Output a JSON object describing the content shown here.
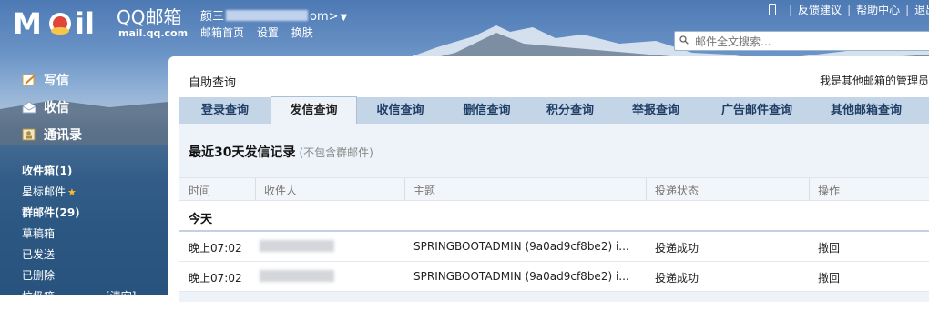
{
  "header": {
    "brand": "QQ邮箱",
    "brand_url": "mail.qq.com",
    "account_prefix": "颜三",
    "account_suffix": "om>",
    "nav": [
      "邮箱首页",
      "设置",
      "换肤"
    ],
    "top_links": [
      "反馈建议",
      "帮助中心",
      "退出"
    ],
    "search_placeholder": "邮件全文搜索..."
  },
  "sidebar": {
    "main": [
      "写信",
      "收信",
      "通讯录"
    ],
    "folders": {
      "inbox": "收件箱(1)",
      "starred": "星标邮件",
      "group": "群邮件(29)",
      "drafts": "草稿箱",
      "sent": "已发送",
      "deleted": "已删除",
      "spam": "垃圾箱",
      "spam_action": "[清空]"
    }
  },
  "panel": {
    "title": "自助查询",
    "admin_link": "我是其他邮箱的管理员",
    "tabs": [
      "登录查询",
      "发信查询",
      "收信查询",
      "删信查询",
      "积分查询",
      "举报查询",
      "广告邮件查询",
      "其他邮箱查询"
    ],
    "active_tab": "发信查询",
    "section_title": "最近30天发信记录",
    "section_note": "(不包含群邮件)",
    "columns": [
      "时间",
      "收件人",
      "主题",
      "投递状态",
      "操作"
    ],
    "group_label": "今天",
    "rows": [
      {
        "time": "晚上07:02",
        "subject": "SPRINGBOOTADMIN (9a0ad9cf8be2) i...",
        "status": "投递成功",
        "action": "撤回"
      },
      {
        "time": "晚上07:02",
        "subject": "SPRINGBOOTADMIN (9a0ad9cf8be2) i...",
        "status": "投递成功",
        "action": "撤回"
      }
    ]
  }
}
